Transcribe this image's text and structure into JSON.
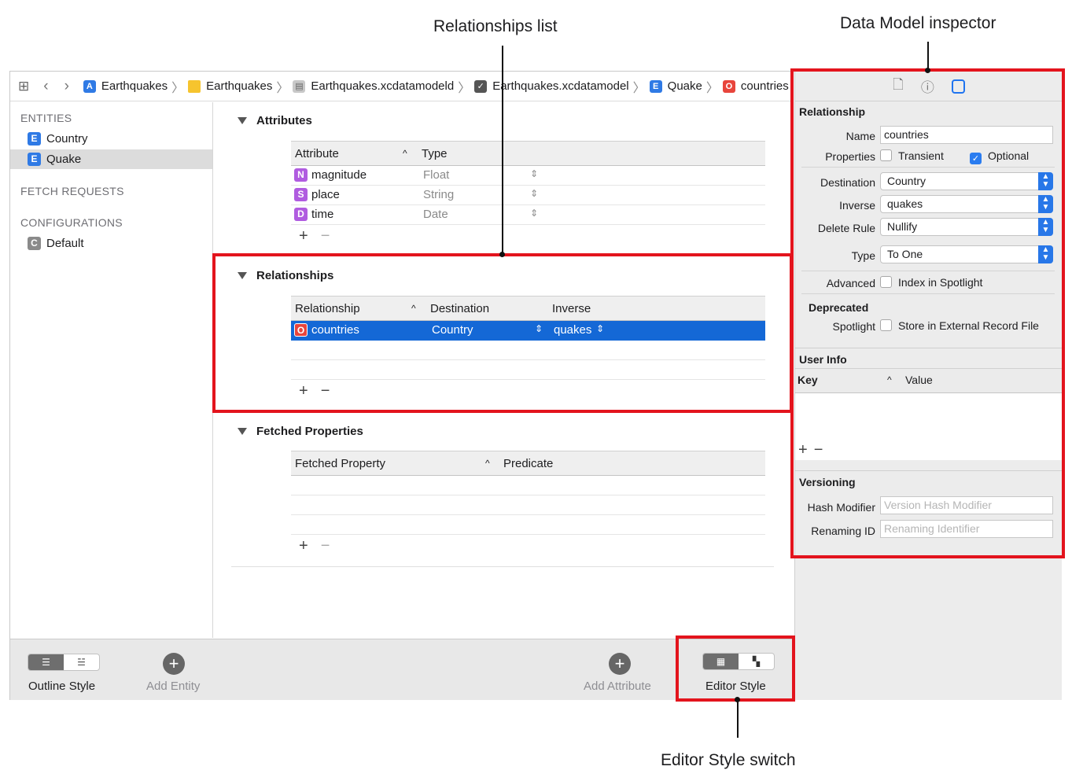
{
  "callouts": {
    "relationships_list": "Relationships list",
    "data_model_inspector": "Data Model inspector",
    "editor_style_switch": "Editor Style switch"
  },
  "breadcrumb": [
    {
      "label": "Earthquakes",
      "icon": "app-project-icon"
    },
    {
      "label": "Earthquakes",
      "icon": "folder-icon"
    },
    {
      "label": "Earthquakes.xcdatamodeld",
      "icon": "model-bundle-icon"
    },
    {
      "label": "Earthquakes.xcdatamodel",
      "icon": "model-file-icon"
    },
    {
      "label": "Quake",
      "icon": "entity-icon"
    },
    {
      "label": "countries",
      "icon": "relationship-icon"
    }
  ],
  "sidebar": {
    "entities_header": "ENTITIES",
    "entities": [
      {
        "badge": "E",
        "label": "Country"
      },
      {
        "badge": "E",
        "label": "Quake"
      }
    ],
    "fetch_requests_header": "FETCH REQUESTS",
    "configurations_header": "CONFIGURATIONS",
    "configurations": [
      {
        "badge": "C",
        "label": "Default"
      }
    ]
  },
  "attributes": {
    "title": "Attributes",
    "col_attribute": "Attribute",
    "col_type": "Type",
    "rows": [
      {
        "badge": "N",
        "name": "magnitude",
        "type": "Float"
      },
      {
        "badge": "S",
        "name": "place",
        "type": "String"
      },
      {
        "badge": "D",
        "name": "time",
        "type": "Date"
      }
    ]
  },
  "relationships": {
    "title": "Relationships",
    "col_relationship": "Relationship",
    "col_destination": "Destination",
    "col_inverse": "Inverse",
    "rows": [
      {
        "badge": "O",
        "name": "countries",
        "destination": "Country",
        "inverse": "quakes"
      }
    ]
  },
  "fetched_properties": {
    "title": "Fetched Properties",
    "col_fetched_property": "Fetched Property",
    "col_predicate": "Predicate"
  },
  "bottombar": {
    "outline_style": "Outline Style",
    "add_entity": "Add Entity",
    "add_attribute": "Add Attribute",
    "editor_style": "Editor Style"
  },
  "inspector": {
    "relationship_header": "Relationship",
    "name_label": "Name",
    "name_value": "countries",
    "properties_label": "Properties",
    "transient_label": "Transient",
    "optional_label": "Optional",
    "destination_label": "Destination",
    "destination_value": "Country",
    "inverse_label": "Inverse",
    "inverse_value": "quakes",
    "delete_rule_label": "Delete Rule",
    "delete_rule_value": "Nullify",
    "type_label": "Type",
    "type_value": "To One",
    "advanced_label": "Advanced",
    "index_spotlight_label": "Index in Spotlight",
    "deprecated_label": "Deprecated",
    "spotlight_label": "Spotlight",
    "external_record_label": "Store in External Record File",
    "user_info_header": "User Info",
    "key_col": "Key",
    "value_col": "Value",
    "versioning_header": "Versioning",
    "hash_modifier_label": "Hash Modifier",
    "hash_modifier_placeholder": "Version Hash Modifier",
    "renaming_id_label": "Renaming ID",
    "renaming_id_placeholder": "Renaming Identifier"
  },
  "colors": {
    "callout_red": "#e3141d",
    "selection_blue": "#1468d6",
    "entity_badge": "#2f7ae5",
    "attr_badge": "#b05ce0",
    "relationship_badge": "#e8453c",
    "config_badge": "#8a8a8a"
  }
}
